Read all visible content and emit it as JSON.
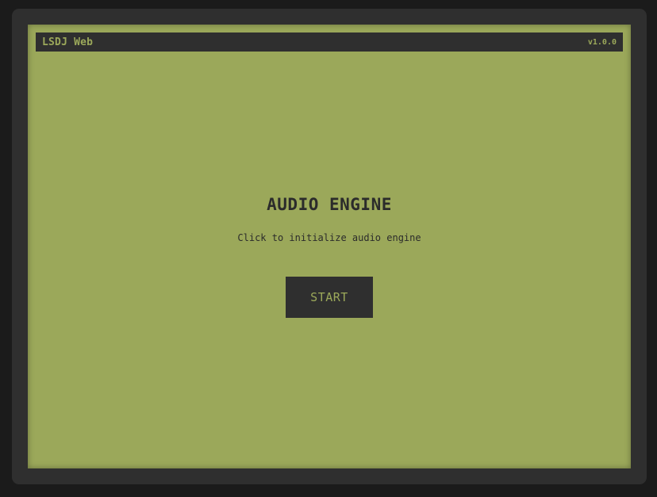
{
  "header": {
    "title": "LSDJ Web",
    "version": "v1.0.0"
  },
  "main": {
    "heading": "AUDIO ENGINE",
    "instruction": "Click to initialize audio engine",
    "start_label": "START"
  },
  "colors": {
    "screen": "#9ba85a",
    "dark": "#2f2f2f",
    "background": "#1b1b1b"
  }
}
